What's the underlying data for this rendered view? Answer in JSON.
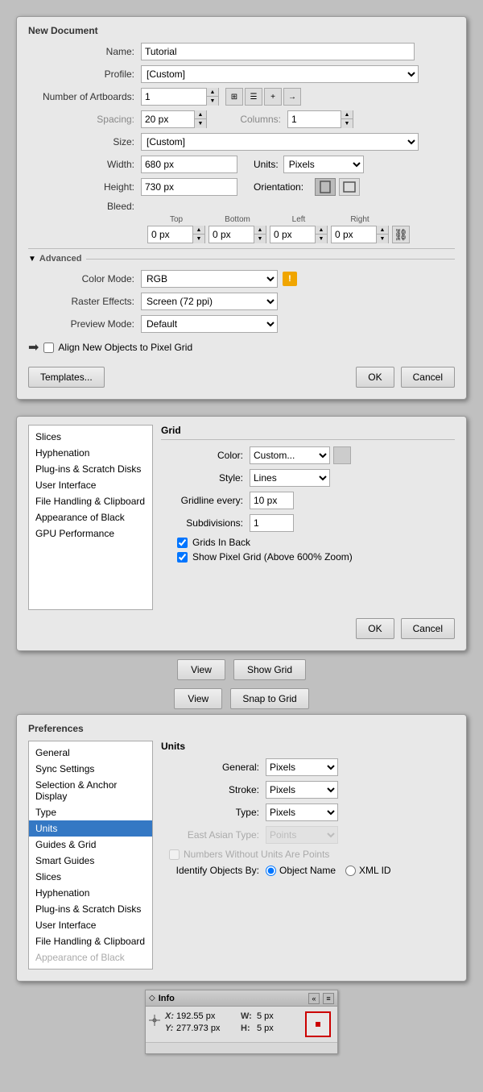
{
  "newDocDialog": {
    "title": "New Document",
    "nameLabel": "Name:",
    "nameValue": "Tutorial",
    "profileLabel": "Profile:",
    "profileValue": "[Custom]",
    "artboardsLabel": "Number of Artboards:",
    "artboardsValue": "1",
    "spacingLabel": "Spacing:",
    "spacingValue": "20 px",
    "columnsLabel": "Columns:",
    "columnsValue": "1",
    "sizeLabel": "Size:",
    "sizeValue": "[Custom]",
    "widthLabel": "Width:",
    "widthValue": "680 px",
    "unitsLabel": "Units:",
    "unitsValue": "Pixels",
    "heightLabel": "Height:",
    "heightValue": "730 px",
    "orientationLabel": "Orientation:",
    "bleedLabel": "Bleed:",
    "bleedTop": "0 px",
    "bleedBottom": "0 px",
    "bleedLeft": "0 px",
    "bleedRight": "0 px",
    "bleedTopLabel": "Top",
    "bleedBottomLabel": "Bottom",
    "bleedLeftLabel": "Left",
    "bleedRightLabel": "Right",
    "advancedLabel": "Advanced",
    "colorModeLabel": "Color Mode:",
    "colorModeValue": "RGB",
    "rasterEffectsLabel": "Raster Effects:",
    "rasterEffectsValue": "Screen (72 ppi)",
    "previewModeLabel": "Preview Mode:",
    "previewModeValue": "Default",
    "alignLabel": "Align New Objects to Pixel Grid",
    "templatesBtn": "Templates...",
    "okBtn": "OK",
    "cancelBtn": "Cancel"
  },
  "prefsGridDialog": {
    "sidebarItems": [
      "Slices",
      "Hyphenation",
      "Plug-ins & Scratch Disks",
      "User Interface",
      "File Handling & Clipboard",
      "Appearance of Black",
      "GPU Performance"
    ],
    "mainTitle": "Grid",
    "colorLabel": "Color:",
    "colorValue": "Custom...",
    "styleLabel": "Style:",
    "styleValue": "Lines",
    "gridlineLabel": "Gridline every:",
    "gridlineValue": "10 px",
    "subdivisionsLabel": "Subdivisions:",
    "subdivisionsValue": "1",
    "gridsInBackLabel": "Grids In Back",
    "gridsInBackChecked": true,
    "showPixelGridLabel": "Show Pixel Grid (Above 600% Zoom)",
    "showPixelGridChecked": true,
    "okBtn": "OK",
    "cancelBtn": "Cancel"
  },
  "viewButtons": {
    "showGridRow": {
      "viewLabel": "View",
      "actionLabel": "Show Grid"
    },
    "snapGridRow": {
      "viewLabel": "View",
      "actionLabel": "Snap to Grid"
    }
  },
  "prefsUnitsDialog": {
    "title": "Preferences",
    "sidebarItems": [
      {
        "label": "General",
        "active": false
      },
      {
        "label": "Sync Settings",
        "active": false
      },
      {
        "label": "Selection & Anchor Display",
        "active": false
      },
      {
        "label": "Type",
        "active": false
      },
      {
        "label": "Units",
        "active": true
      },
      {
        "label": "Guides & Grid",
        "active": false
      },
      {
        "label": "Smart Guides",
        "active": false
      },
      {
        "label": "Slices",
        "active": false
      },
      {
        "label": "Hyphenation",
        "active": false
      },
      {
        "label": "Plug-ins & Scratch Disks",
        "active": false
      },
      {
        "label": "User Interface",
        "active": false
      },
      {
        "label": "File Handling & Clipboard",
        "active": false
      },
      {
        "label": "Appearance of Black",
        "active": false
      }
    ],
    "sectionTitle": "Units",
    "generalLabel": "General:",
    "generalValue": "Pixels",
    "strokeLabel": "Stroke:",
    "strokeValue": "Pixels",
    "typeLabel": "Type:",
    "typeValue": "Pixels",
    "eastAsianLabel": "East Asian Type:",
    "eastAsianValue": "Points",
    "eastAsianDisabled": true,
    "numbersWithoutUnitsLabel": "Numbers Without Units Are Points",
    "numbersWithoutUnitsDisabled": true,
    "identifyLabel": "Identify Objects By:",
    "objectNameLabel": "Object Name",
    "xmlIdLabel": "XML ID"
  },
  "infoPanel": {
    "title": "Info",
    "xLabel": "X:",
    "xValue": "192.55 px",
    "yLabel": "Y:",
    "yValue": "277.973 px",
    "wLabel": "W:",
    "wValue": "5 px",
    "hLabel": "H:",
    "hValue": "5 px"
  }
}
